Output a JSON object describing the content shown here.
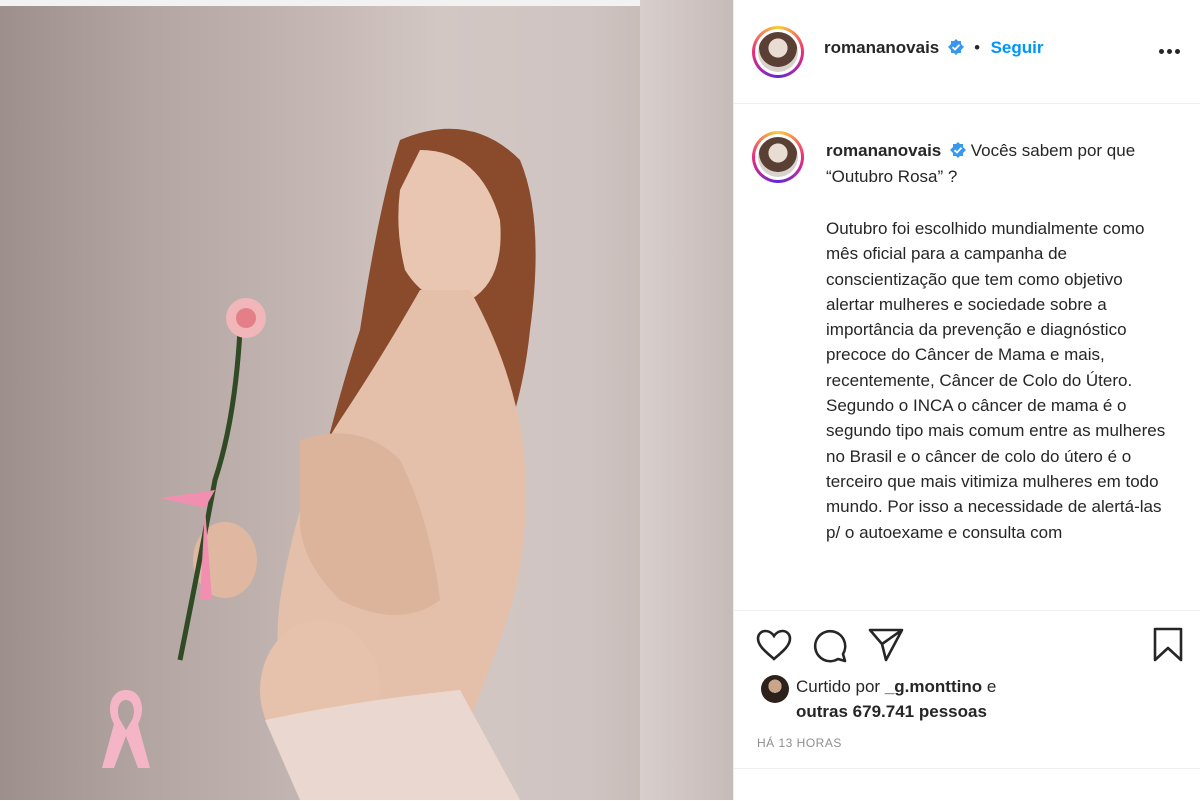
{
  "header": {
    "username": "romananovais",
    "separator": "•",
    "follow_label": "Seguir"
  },
  "caption": {
    "username": "romananovais",
    "lead": "Vocês sabem por que “Outubro Rosa” ?",
    "body": "Outubro foi escolhido mundialmente como mês oficial para a campanha de conscientização que tem como objetivo alertar mulheres e sociedade sobre a importância da prevenção e diagnóstico precoce do Câncer de Mama e mais, recentemente, Câncer de Colo do Útero. Segundo o INCA o câncer de mama é o segundo tipo mais comum entre as mulheres no Brasil e o câncer de colo do útero é o terceiro que mais vitimiza mulheres em todo mundo. Por isso a necessidade de alertá-las p/ o autoexame e consulta com"
  },
  "likes": {
    "prefix": "Curtido por",
    "user": "_g.monttino",
    "conj": "e",
    "others": "outras 679.741 pessoas"
  },
  "timestamp": "HÁ 13 HORAS",
  "colors": {
    "follow": "#0095f6",
    "verified": "#3897f0",
    "text": "#262626",
    "muted": "#8e8e8e",
    "ribbon": "#f4b6c6"
  },
  "icons": [
    "heart-icon",
    "comment-icon",
    "share-icon",
    "bookmark-icon",
    "more-options-icon",
    "verified-badge-icon",
    "pink-ribbon-icon"
  ]
}
